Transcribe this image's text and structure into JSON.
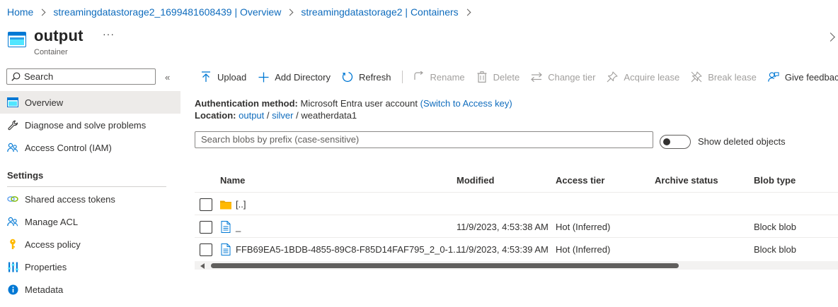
{
  "breadcrumb": [
    "Home",
    "streamingdatastorage2_1699481608439 | Overview",
    "streamingdatastorage2 | Containers"
  ],
  "header": {
    "title": "output",
    "subtitle": "Container",
    "more": "···"
  },
  "sidebar": {
    "search_placeholder": "Search",
    "collapse": "«",
    "items": [
      {
        "label": "Overview",
        "icon": "container-overview-icon",
        "active": true
      },
      {
        "label": "Diagnose and solve problems",
        "icon": "wrench-icon"
      },
      {
        "label": "Access Control (IAM)",
        "icon": "people-icon"
      }
    ],
    "settings_header": "Settings",
    "settings_items": [
      {
        "label": "Shared access tokens",
        "icon": "link-icon"
      },
      {
        "label": "Manage ACL",
        "icon": "people-icon"
      },
      {
        "label": "Access policy",
        "icon": "key-icon"
      },
      {
        "label": "Properties",
        "icon": "sliders-icon"
      },
      {
        "label": "Metadata",
        "icon": "info-icon"
      }
    ]
  },
  "toolbar": {
    "upload": "Upload",
    "add_directory": "Add Directory",
    "refresh": "Refresh",
    "rename": "Rename",
    "delete": "Delete",
    "change_tier": "Change tier",
    "acquire_lease": "Acquire lease",
    "break_lease": "Break lease",
    "give_feedback": "Give feedback"
  },
  "info": {
    "auth_label": "Authentication method:",
    "auth_value": "Microsoft Entra user account",
    "auth_switch": "(Switch to Access key)",
    "location_label": "Location:",
    "location_parts": [
      "output",
      "silver",
      "weatherdata1"
    ],
    "location_sep": "/"
  },
  "blob_search": {
    "placeholder": "Search blobs by prefix (case-sensitive)"
  },
  "show_deleted": {
    "label": "Show deleted objects",
    "on": false
  },
  "table": {
    "headers": [
      "Name",
      "Modified",
      "Access tier",
      "Archive status",
      "Blob type"
    ],
    "rows": [
      {
        "type": "folder",
        "name": "[..]",
        "modified": "",
        "access_tier": "",
        "archive_status": "",
        "blob_type": ""
      },
      {
        "type": "file",
        "name": "_",
        "modified": "11/9/2023, 4:53:38 AM",
        "access_tier": "Hot (Inferred)",
        "archive_status": "",
        "blob_type": "Block blob"
      },
      {
        "type": "file",
        "name": "FFB69EA5-1BDB-4855-89C8-F85D14FAF795_2_0-1....",
        "modified": "11/9/2023, 4:53:39 AM",
        "access_tier": "Hot (Inferred)",
        "archive_status": "",
        "blob_type": "Block blob"
      }
    ]
  },
  "colors": {
    "link": "#0f6cbd",
    "active_nav_bg": "#edebe9",
    "folder": "#ffb900",
    "disabled": "#a19f9d"
  }
}
